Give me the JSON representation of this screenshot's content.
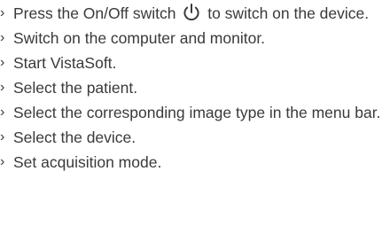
{
  "bullet_char": "›",
  "steps": [
    {
      "before_icon": "Press the On/Off switch ",
      "icon": "power-icon",
      "after_icon": " to switch on the device."
    },
    {
      "text": "Switch on the computer and monitor."
    },
    {
      "text": "Start VistaSoft."
    },
    {
      "text": "Select the patient."
    },
    {
      "text": "Select the corresponding image type in the menu bar."
    },
    {
      "text": "Select the device."
    },
    {
      "text": "Set acquisition mode."
    }
  ],
  "colors": {
    "text": "#3a3a3a",
    "background": "#ffffff"
  }
}
